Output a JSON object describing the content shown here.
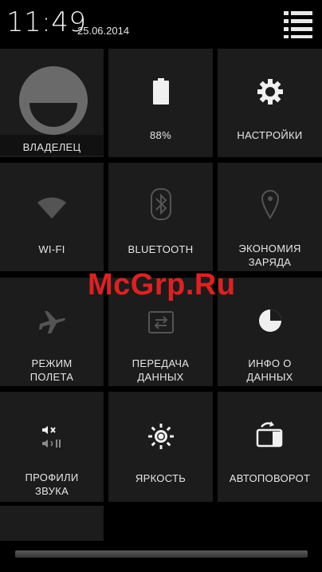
{
  "status_bar": {
    "time": "11:49",
    "date": "25.06.2014",
    "menu_icon": "list-menu-icon"
  },
  "tiles": {
    "owner": {
      "label": "ВЛАДЕЛЕЦ",
      "icon": "user-avatar-icon"
    },
    "battery": {
      "label": "88%",
      "icon": "battery-icon",
      "level": 0.88
    },
    "settings": {
      "label": "НАСТРОЙКИ",
      "icon": "gear-icon"
    },
    "wifi": {
      "label": "WI-FI",
      "icon": "wifi-icon",
      "enabled": false
    },
    "bluetooth": {
      "label": "BLUETOOTH",
      "icon": "bluetooth-icon",
      "enabled": false
    },
    "power_saving": {
      "label": "ЭКОНОМИЯ\nЗАРЯДА",
      "icon": "location-pin-icon",
      "enabled": false
    },
    "airplane": {
      "label": "РЕЖИМ\nПОЛЕТА",
      "icon": "airplane-icon",
      "enabled": false
    },
    "data_transfer": {
      "label": "ПЕРЕДАЧА\nДАННЫХ",
      "icon": "data-transfer-icon",
      "enabled": false
    },
    "data_info": {
      "label": "ИНФО О\nДАННЫХ",
      "icon": "pie-chart-icon"
    },
    "sound_profiles": {
      "label": "ПРОФИЛИ\nЗВУКА",
      "icon": "sound-profile-icon"
    },
    "brightness": {
      "label": "ЯРКОСТЬ",
      "icon": "sun-icon"
    },
    "auto_rotate": {
      "label": "АВТОПОВОРОТ",
      "icon": "rotate-icon"
    }
  },
  "watermark": "McGrp.Ru",
  "colors": {
    "tile_bg": "#1c1c1c",
    "background": "#000000",
    "watermark": "#e02020"
  }
}
